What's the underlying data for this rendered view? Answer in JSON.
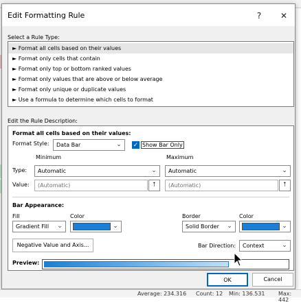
{
  "dialog": {
    "title": "Edit Formatting Rule",
    "help_label": "?",
    "close_label": "✕"
  },
  "rule_type": {
    "label": "Select a Rule Type:",
    "items": [
      "► Format all cells based on their values",
      "► Format only cells that contain",
      "► Format only top or bottom ranked values",
      "► Format only values that are above or below average",
      "► Format only unique or duplicate values",
      "► Use a formula to determine which cells to format"
    ]
  },
  "description": {
    "label": "Edit the Rule Description:",
    "heading": "Format all cells based on their values:",
    "format_style_label": "Format Style:",
    "format_style_value": "Data Bar",
    "show_bar_only_label": "Show Bar Only",
    "show_bar_only_checked": true,
    "minimum_label": "Minimum",
    "maximum_label": "Maximum",
    "type_label": "Type:",
    "value_label": "Value:",
    "min_type": "Automatic",
    "max_type": "Automatic",
    "min_value": "(Automatic)",
    "max_value": "(Automatic)"
  },
  "bar_appearance": {
    "label": "Bar Appearance:",
    "fill_label": "Fill",
    "fill_value": "Gradient Fill",
    "color_label": "Color",
    "fill_color": "#1a7fd6",
    "border_label": "Border",
    "border_value": "Solid Border",
    "border_color_label": "Color",
    "border_color": "#1a7fd6",
    "negative_button": "Negative Value and Axis...",
    "bar_direction_label": "Bar Direction:",
    "bar_direction_value": "Context"
  },
  "preview": {
    "label": "Preview:",
    "fill_fraction": 0.75
  },
  "buttons": {
    "ok": "OK",
    "cancel": "Cancel"
  },
  "statusbar": {
    "average": "Average: 234.316",
    "count": "Count: 12",
    "min": "Min: 136.531",
    "max": "Max: 442"
  }
}
